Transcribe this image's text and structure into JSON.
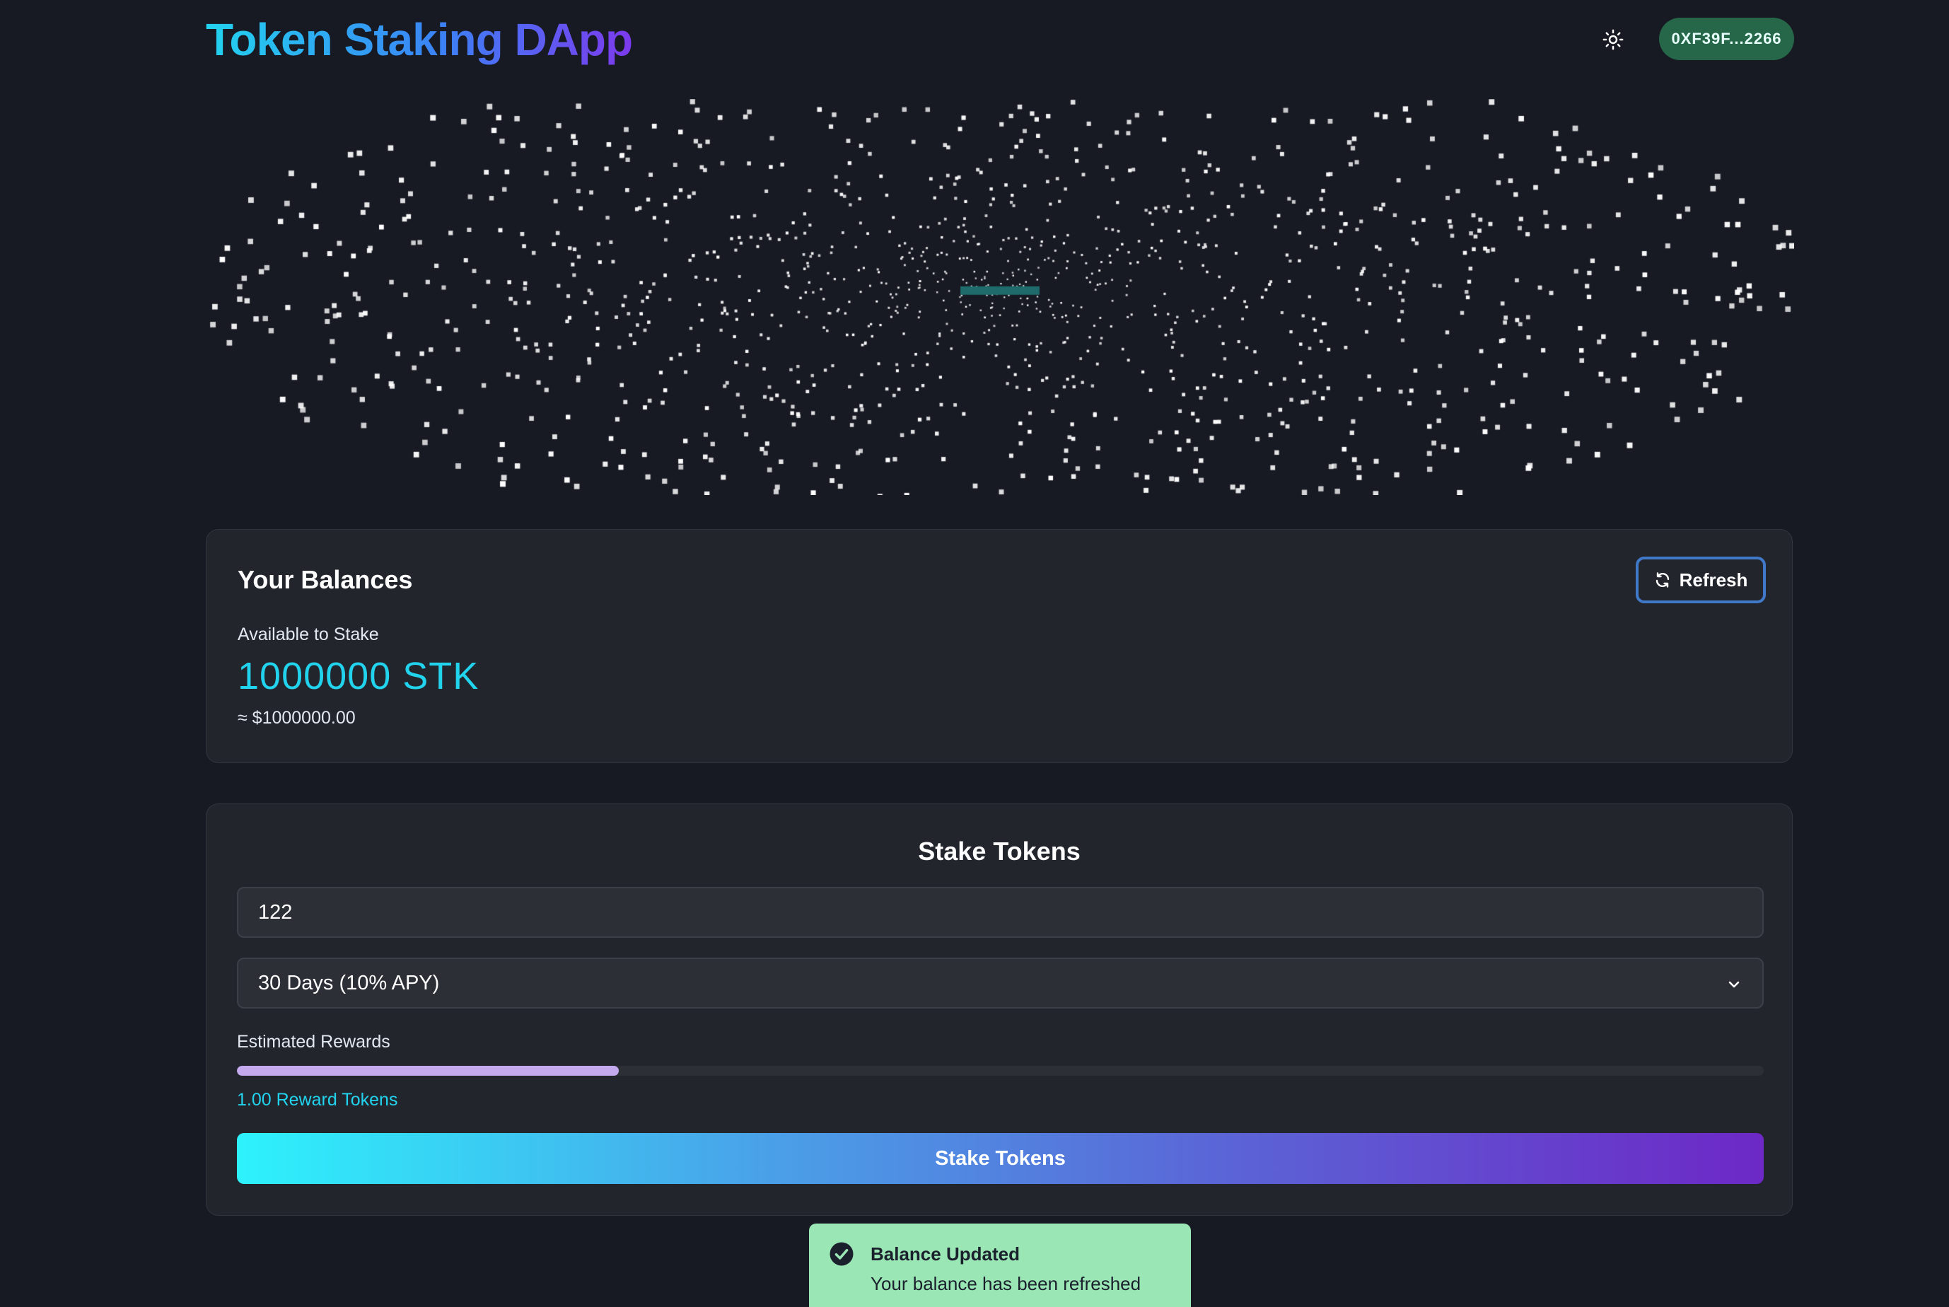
{
  "header": {
    "title": "Token Staking DApp",
    "theme_icon": "sun-icon",
    "wallet_address": "0XF39F...2266"
  },
  "balances": {
    "title": "Your Balances",
    "refresh_label": "Refresh",
    "refresh_icon": "refresh-icon",
    "available_label": "Available to Stake",
    "available_amount": "1000000 STK",
    "usd_value": "≈ $1000000.00"
  },
  "stake": {
    "title": "Stake Tokens",
    "amount_value": "122",
    "duration_selected": "30 Days (10% APY)",
    "rewards_label": "Estimated Rewards",
    "rewards_progress": 0.25,
    "rewards_value": "1.00 Reward Tokens",
    "button_label": "Stake Tokens"
  },
  "toast": {
    "icon": "check-circle-icon",
    "title": "Balance Updated",
    "description": "Your balance has been refreshed"
  },
  "colors": {
    "background": "#171923",
    "card": "#23252d",
    "accent_cyan": "#22d3ee",
    "accent_purple": "#6d28c6",
    "wallet_badge": "#276749",
    "toast_bg": "#9ae6b4",
    "progress_fill": "#c4a9ee"
  }
}
